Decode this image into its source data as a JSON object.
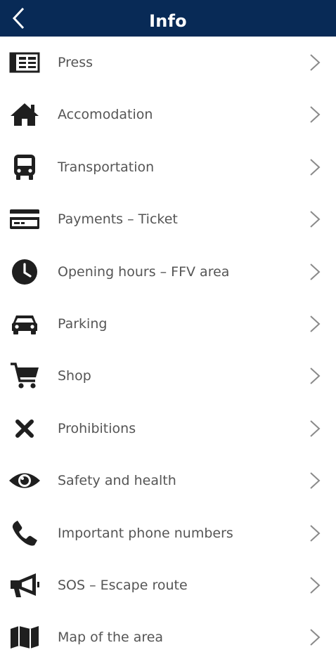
{
  "header": {
    "title": "Info",
    "back_icon": "chevron-left-icon"
  },
  "items": [
    {
      "label": "Press",
      "icon": "newspaper-icon"
    },
    {
      "label": "Accomodation",
      "icon": "house-icon"
    },
    {
      "label": "Transportation",
      "icon": "bus-icon"
    },
    {
      "label": "Payments – Ticket",
      "icon": "credit-card-icon"
    },
    {
      "label": "Opening hours – FFV area",
      "icon": "clock-icon"
    },
    {
      "label": "Parking",
      "icon": "car-icon"
    },
    {
      "label": "Shop",
      "icon": "shopping-cart-icon"
    },
    {
      "label": "Prohibitions",
      "icon": "x-mark-icon"
    },
    {
      "label": "Safety and health",
      "icon": "eye-icon"
    },
    {
      "label": "Important phone numbers",
      "icon": "phone-icon"
    },
    {
      "label": "SOS – Escape route",
      "icon": "megaphone-icon"
    },
    {
      "label": "Map of the area",
      "icon": "map-icon"
    }
  ],
  "colors": {
    "header_bg": "#082a56",
    "icon": "#1f1f1f",
    "label": "#555555",
    "chevron": "#8a8a8a"
  }
}
